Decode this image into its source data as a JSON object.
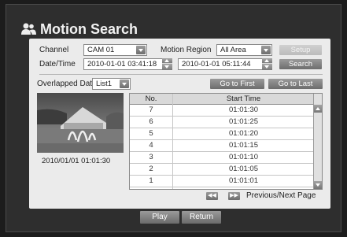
{
  "title": "Motion Search",
  "icons": {
    "title": "user-icon",
    "first_page": "rewind-icon",
    "next_page": "fast-forward-icon"
  },
  "filters": {
    "channel_label": "Channel",
    "channel_value": "CAM 01",
    "region_label": "Motion Region",
    "region_value": "All Area",
    "setup_label": "Setup",
    "datetime_label": "Date/Time",
    "start_datetime": "2010-01-01  03:41:18",
    "end_datetime": "2010-01-01  05:11:44",
    "search_label": "Search"
  },
  "overlap": {
    "label": "Overlapped Data",
    "value": "List1",
    "go_first_label": "Go to First",
    "go_last_label": "Go to Last"
  },
  "preview": {
    "timestamp": "2010/01/01  01:01:30"
  },
  "table": {
    "headers": [
      "No.",
      "Start Time"
    ],
    "rows": [
      {
        "no": "7",
        "time": "01:01:30"
      },
      {
        "no": "6",
        "time": "01:01:25"
      },
      {
        "no": "5",
        "time": "01:01:20"
      },
      {
        "no": "4",
        "time": "01:01:15"
      },
      {
        "no": "3",
        "time": "01:01:10"
      },
      {
        "no": "2",
        "time": "01:01:05"
      },
      {
        "no": "1",
        "time": "01:01:01"
      }
    ]
  },
  "paging": {
    "label": "Previous/Next Page"
  },
  "footer": {
    "play_label": "Play",
    "return_label": "Return"
  },
  "colors": {
    "background": "#1c1c1c",
    "panel": "#ebebeb",
    "button": "#7d7d7d"
  }
}
